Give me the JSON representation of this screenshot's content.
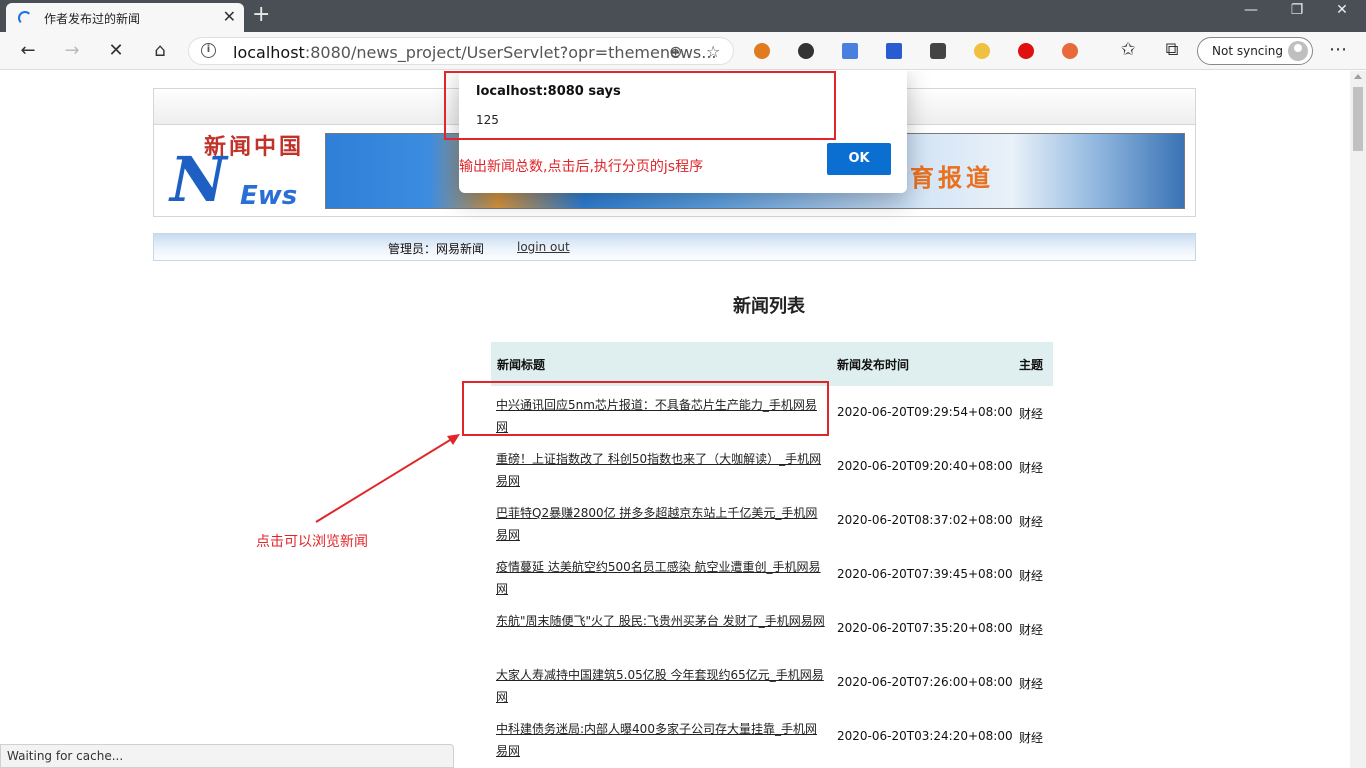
{
  "browser": {
    "tab_title": "作者发布过的新闻",
    "url_host": "localhost",
    "url_rest": ":8080/news_project/UserServlet?opr=themenews...",
    "sync_label": "Not syncing",
    "status": "Waiting for cache..."
  },
  "header": {
    "logo_cn": "新闻中国",
    "logo_n": "N",
    "logo_ews": "Ews",
    "banner_text": "育报道"
  },
  "admin": {
    "label": "管理员：网易新闻",
    "logout": "login out"
  },
  "list": {
    "title": "新闻列表",
    "columns": [
      "新闻标题",
      "新闻发布时间",
      "主题"
    ],
    "rows": [
      {
        "title": "中兴通讯回应5nm芯片报道：不具备芯片生产能力_手机网易网",
        "date": "2020-06-20T09:29:54+08:00",
        "topic": "财经"
      },
      {
        "title": "重磅！上证指数改了 科创50指数也来了（大咖解读）_手机网易网",
        "date": "2020-06-20T09:20:40+08:00",
        "topic": "财经"
      },
      {
        "title": "巴菲特Q2暴赚2800亿 拼多多超越京东站上千亿美元_手机网易网",
        "date": "2020-06-20T08:37:02+08:00",
        "topic": "财经"
      },
      {
        "title": "疫情蔓延 达美航空约500名员工感染 航空业遭重创_手机网易网",
        "date": "2020-06-20T07:39:45+08:00",
        "topic": "财经"
      },
      {
        "title": "东航\"周末随便飞\"火了 股民:飞贵州买茅台 发财了_手机网易网",
        "date": "2020-06-20T07:35:20+08:00",
        "topic": "财经"
      },
      {
        "title": "大家人寿减持中国建筑5.05亿股 今年套现约65亿元_手机网易网",
        "date": "2020-06-20T07:26:00+08:00",
        "topic": "财经"
      },
      {
        "title": "中科建债务迷局:内部人曝400多家子公司存大量挂靠_手机网易网",
        "date": "2020-06-20T03:24:20+08:00",
        "topic": "财经"
      }
    ]
  },
  "dialog": {
    "host": "localhost:8080 says",
    "message": "125",
    "ok": "OK",
    "note": "输出新闻总数,点击后,执行分页的js程序"
  },
  "annotation": {
    "click_hint": "点击可以浏览新闻"
  },
  "colors": {
    "annotation": "#e0262a",
    "ok_button": "#0a6fd0"
  }
}
